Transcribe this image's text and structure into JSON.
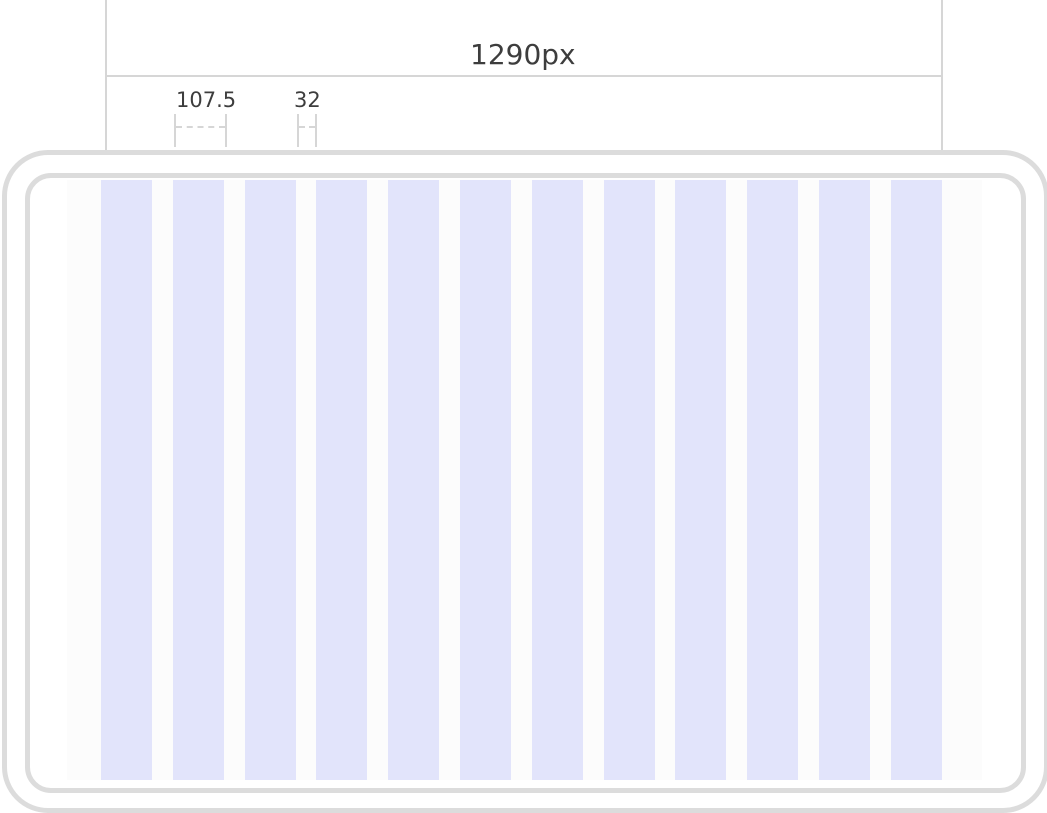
{
  "total_width_label": "1290px",
  "column_width_label": "107.5",
  "gutter_width_label": "32",
  "column_count": 12,
  "colors": {
    "column_fill": "#e2e4fb",
    "frame_stroke": "#dcdcdc",
    "margin_fill": "#fcfcfc",
    "label_text": "#3d3d3d"
  }
}
